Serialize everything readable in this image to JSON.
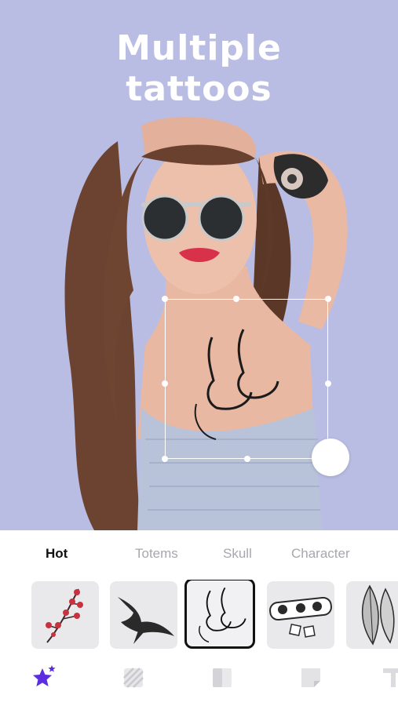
{
  "headline": {
    "line1": "Multiple",
    "line2": "tattoos"
  },
  "colors": {
    "hero_bg": "#b9bde3",
    "accent": "#5b2de0",
    "selected_border": "#111111"
  },
  "tabs": [
    {
      "label": "Hot",
      "active": true
    },
    {
      "label": "Totems",
      "active": false
    },
    {
      "label": "Skull",
      "active": false
    },
    {
      "label": "Character",
      "active": false
    }
  ],
  "tattoo_thumbnails": [
    {
      "name": "cherry-blossom-branch",
      "selected": false
    },
    {
      "name": "swallow-bird",
      "selected": false
    },
    {
      "name": "two-faces",
      "selected": true
    },
    {
      "name": "eye-skull-dice",
      "selected": false
    },
    {
      "name": "feather",
      "selected": false
    }
  ],
  "toolbar": [
    {
      "icon": "star-sticker-icon",
      "active": true
    },
    {
      "icon": "pattern-icon",
      "active": false
    },
    {
      "icon": "layers-icon",
      "active": false
    },
    {
      "icon": "sticker-peel-icon",
      "active": false
    },
    {
      "icon": "text-icon",
      "active": false
    }
  ]
}
